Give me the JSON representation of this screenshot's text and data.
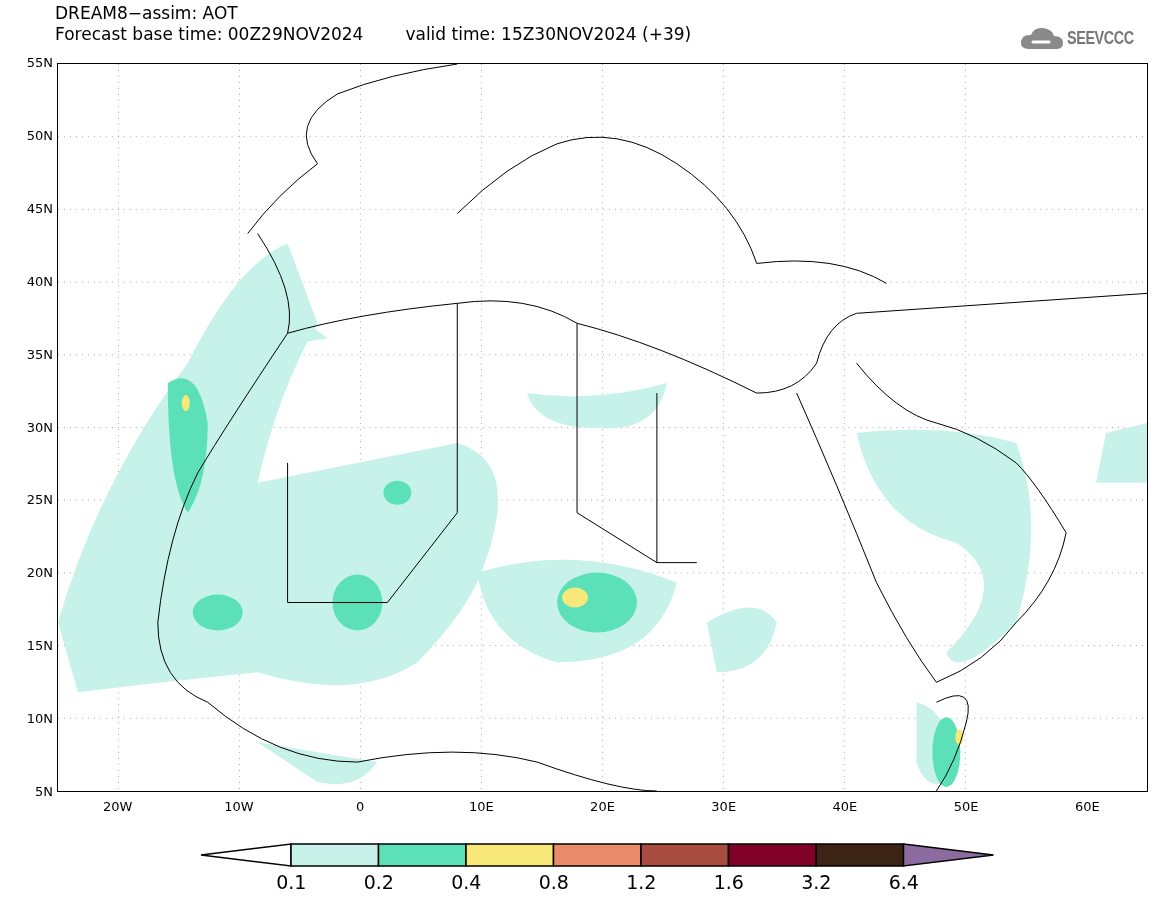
{
  "header": {
    "title": "DREAM8−assim: AOT",
    "base_time": "Forecast base time: 00Z29NOV2024",
    "valid_time": "valid time: 15Z30NOV2024 (+39)",
    "logo_text": "SEEVCCC"
  },
  "map": {
    "y_labels": [
      "55N",
      "50N",
      "45N",
      "40N",
      "35N",
      "30N",
      "25N",
      "20N",
      "15N",
      "10N",
      "5N"
    ],
    "x_labels": [
      "20W",
      "10W",
      "0",
      "10E",
      "20E",
      "30E",
      "40E",
      "50E",
      "60E"
    ]
  },
  "colorbar": {
    "labels": [
      "0.1",
      "0.2",
      "0.4",
      "0.8",
      "1.2",
      "1.6",
      "3.2",
      "6.4"
    ],
    "segments": [
      {
        "color": "#c6f2ea"
      },
      {
        "color": "#5ce0b8"
      },
      {
        "color": "#f8e87a"
      },
      {
        "color": "#ea8c6c"
      },
      {
        "color": "#a84c40"
      },
      {
        "color": "#800028"
      },
      {
        "color": "#3c2414"
      }
    ],
    "low_end": {
      "color": "#ffffff"
    },
    "high_end": {
      "color": "#8c6ca0"
    }
  }
}
